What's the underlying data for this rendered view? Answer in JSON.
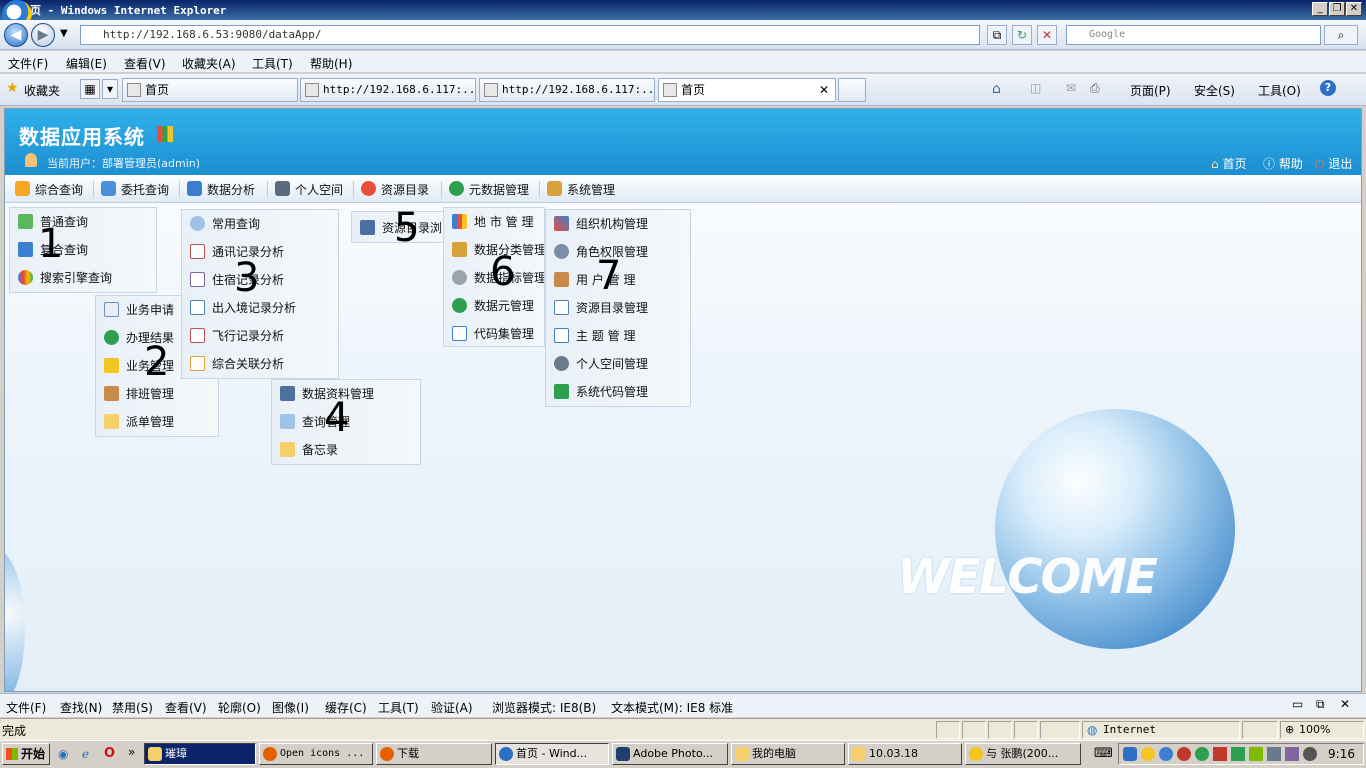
{
  "window": {
    "title": "页 - Windows Internet Explorer",
    "address": "http://192.168.6.53:9080/dataApp/",
    "search_placeholder": "Google"
  },
  "menubar": [
    "文件(F)",
    "编辑(E)",
    "查看(V)",
    "收藏夹(A)",
    "工具(T)",
    "帮助(H)"
  ],
  "favorites_label": "收藏夹",
  "tabs": [
    {
      "label": "首页"
    },
    {
      "label": "http://192.168.6.117:..."
    },
    {
      "label": "http://192.168.6.117:..."
    },
    {
      "label": "首页",
      "active": true
    }
  ],
  "commandbar": {
    "page": "页面(P)",
    "safety": "安全(S)",
    "tools": "工具(O)"
  },
  "app": {
    "title": "数据应用系统",
    "user_line": "当前用户：部署管理员(admin)",
    "home": "首页",
    "help": "帮助",
    "logout": "退出",
    "welcome": "WELCOME"
  },
  "nav": [
    {
      "label": "综合查询",
      "color": "#f5a623"
    },
    {
      "label": "委托查询",
      "color": "#4a90d9"
    },
    {
      "label": "数据分析",
      "color": "#3c7fd0"
    },
    {
      "label": "个人空间",
      "color": "#5a6b7d"
    },
    {
      "label": "资源目录",
      "color": "#e94e3c"
    },
    {
      "label": "元数据管理",
      "color": "#2e9e4f"
    },
    {
      "label": "系统管理",
      "color": "#d9a13c"
    }
  ],
  "menus": {
    "m1": {
      "num": "1",
      "items": [
        "普通查询",
        "复合查询",
        "搜索引擎查询"
      ]
    },
    "m2": {
      "num": "2",
      "items": [
        "业务申请",
        "办理结果",
        "业务管理",
        "排班管理",
        "派单管理"
      ]
    },
    "m3": {
      "num": "3",
      "items": [
        "常用查询",
        "通讯记录分析",
        "住宿记录分析",
        "出入境记录分析",
        "飞行记录分析",
        "综合关联分析"
      ]
    },
    "m4": {
      "num": "4",
      "items": [
        "数据资料管理",
        "查询管理",
        "备忘录"
      ]
    },
    "m5": {
      "num": "5",
      "items": [
        "资源目录浏览"
      ]
    },
    "m6": {
      "num": "6",
      "items": [
        "地 市 管 理",
        "数据分类管理",
        "数据指标管理",
        "数据元管理",
        "代码集管理"
      ]
    },
    "m7": {
      "num": "7",
      "items": [
        "组织机构管理",
        "角色权限管理",
        "用 户 管 理",
        "资源目录管理",
        "主 题 管 理",
        "个人空间管理",
        "系统代码管理"
      ]
    }
  },
  "devbar": [
    "文件(F)",
    "查找(N)",
    "禁用(S)",
    "查看(V)",
    "轮廓(O)",
    "图像(I)",
    "缓存(C)",
    "工具(T)",
    "验证(A)",
    "浏览器模式: IE8(B)",
    "文本模式(M): IE8 标准"
  ],
  "status": {
    "text": "完成",
    "zone": "Internet",
    "zoom": "100%"
  },
  "taskbar": {
    "start": "开始",
    "tasks": [
      "璀璋",
      "Open icons ...",
      "下载",
      "首页 - Wind...",
      "Adobe Photo...",
      "我的电脑",
      "10.03.18",
      "与 张鹏(200..."
    ],
    "clock": "9:16"
  }
}
